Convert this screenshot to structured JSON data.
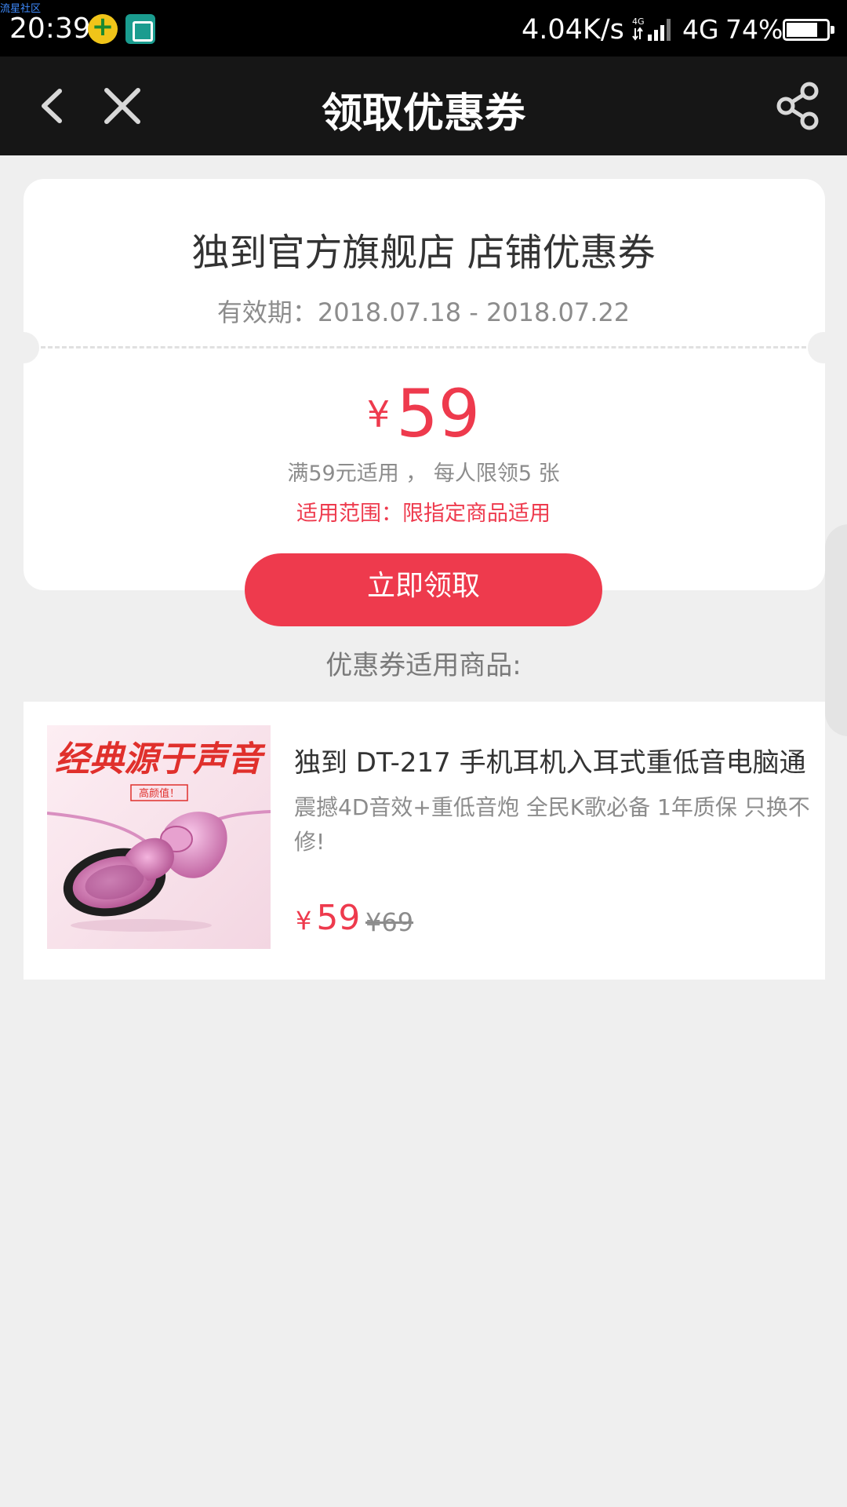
{
  "status_bar": {
    "watermark": "流星社区",
    "time": "20:39",
    "net_speed": "4.04K/s",
    "signal_label": "4G",
    "network": "4G",
    "battery": "74%"
  },
  "nav": {
    "title": "领取优惠券",
    "back_icon": "chevron-left-icon",
    "close_icon": "close-icon",
    "share_icon": "share-icon"
  },
  "coupon": {
    "shop_title": "独到官方旗舰店 店铺优惠券",
    "validity": "有效期：2018.07.18 - 2018.07.22",
    "currency": "¥",
    "amount": "59",
    "usage_rule": "满59元适用 ，  每人限领5 张",
    "scope": "适用范围：限指定商品适用",
    "claim_label": "立即领取"
  },
  "section_heading": "优惠券适用商品:",
  "product": {
    "image_text": "经典源于声音",
    "image_badge": "高颜值！",
    "name": "独到 DT-217 手机耳机入耳式重低音电脑通",
    "description": "震撼4D音效+重低音炮 全民K歌必备 1年质保 只换不修!",
    "currency": "¥",
    "price": "59",
    "original_price": "¥69"
  },
  "colors": {
    "accent": "#ee3a4d",
    "nav_bg": "#161616",
    "page_bg": "#efefef"
  }
}
